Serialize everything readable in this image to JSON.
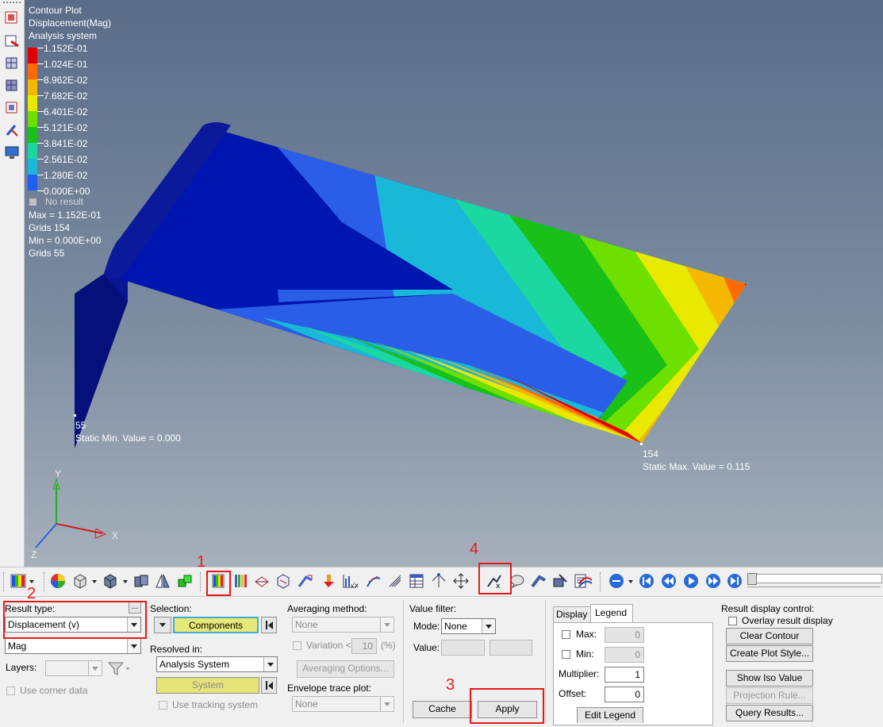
{
  "viewport": {
    "title_lines": [
      "Contour Plot",
      "Displacement(Mag)",
      "Analysis system"
    ],
    "legend": {
      "labels": [
        "1.152E-01",
        "1.024E-01",
        "8.962E-02",
        "7.682E-02",
        "6.401E-02",
        "5.121E-02",
        "3.841E-02",
        "2.561E-02",
        "1.280E-02",
        "0.000E+00"
      ],
      "colors": [
        "#e00000",
        "#ff6a00",
        "#f5b800",
        "#e9e900",
        "#6ee000",
        "#18c018",
        "#1ad8a0",
        "#1cb8d8",
        "#2060f0",
        "#0000b8"
      ],
      "no_result": "No result"
    },
    "stats": [
      "Max = 1.152E-01",
      "Grids 154",
      "Min = 0.000E+00",
      "Grids 55"
    ],
    "min_node": "55",
    "min_text": "Static Min. Value =  0.000",
    "max_node": "154",
    "max_text": "Static Max. Value =  0.115",
    "axes": {
      "y": "Y",
      "x": "X",
      "z": "Z"
    }
  },
  "annotations": {
    "n1": "1",
    "n2": "2",
    "n3": "3",
    "n4": "4"
  },
  "panel": {
    "result_type_label": "Result type:",
    "result_type_value": "Displacement (v)",
    "result_type_more": "...",
    "component_value": "Mag",
    "layers_label": "Layers:",
    "use_corner_data": "Use corner data",
    "selection_label": "Selection:",
    "components_button": "Components",
    "resolved_in_label": "Resolved in:",
    "resolved_in_value": "Analysis System",
    "system_button": "System",
    "use_tracking_system": "Use tracking system",
    "averaging_label": "Averaging method:",
    "averaging_value": "None",
    "variation_label": "Variation <",
    "variation_value": "10",
    "variation_unit": "(%)",
    "averaging_options": "Averaging Options...",
    "envelope_label": "Envelope trace plot:",
    "envelope_value": "None",
    "value_filter_label": "Value filter:",
    "mode_label": "Mode:",
    "mode_value": "None",
    "value_label": "Value:",
    "cache_button": "Cache",
    "apply_button": "Apply",
    "tab_display": "Display",
    "tab_legend": "Legend",
    "max_label": "Max:",
    "max_value": "0",
    "min_label": "Min:",
    "min_value": "0",
    "multiplier_label": "Multiplier:",
    "multiplier_value": "1",
    "offset_label": "Offset:",
    "offset_value": "0",
    "edit_legend": "Edit Legend",
    "rdc_label": "Result display control:",
    "overlay_label": "Overlay result display",
    "clear_contour": "Clear Contour",
    "create_plot_style": "Create Plot Style...",
    "show_iso_value": "Show Iso Value",
    "projection_rule": "Projection Rule...",
    "query_results": "Query Results..."
  }
}
